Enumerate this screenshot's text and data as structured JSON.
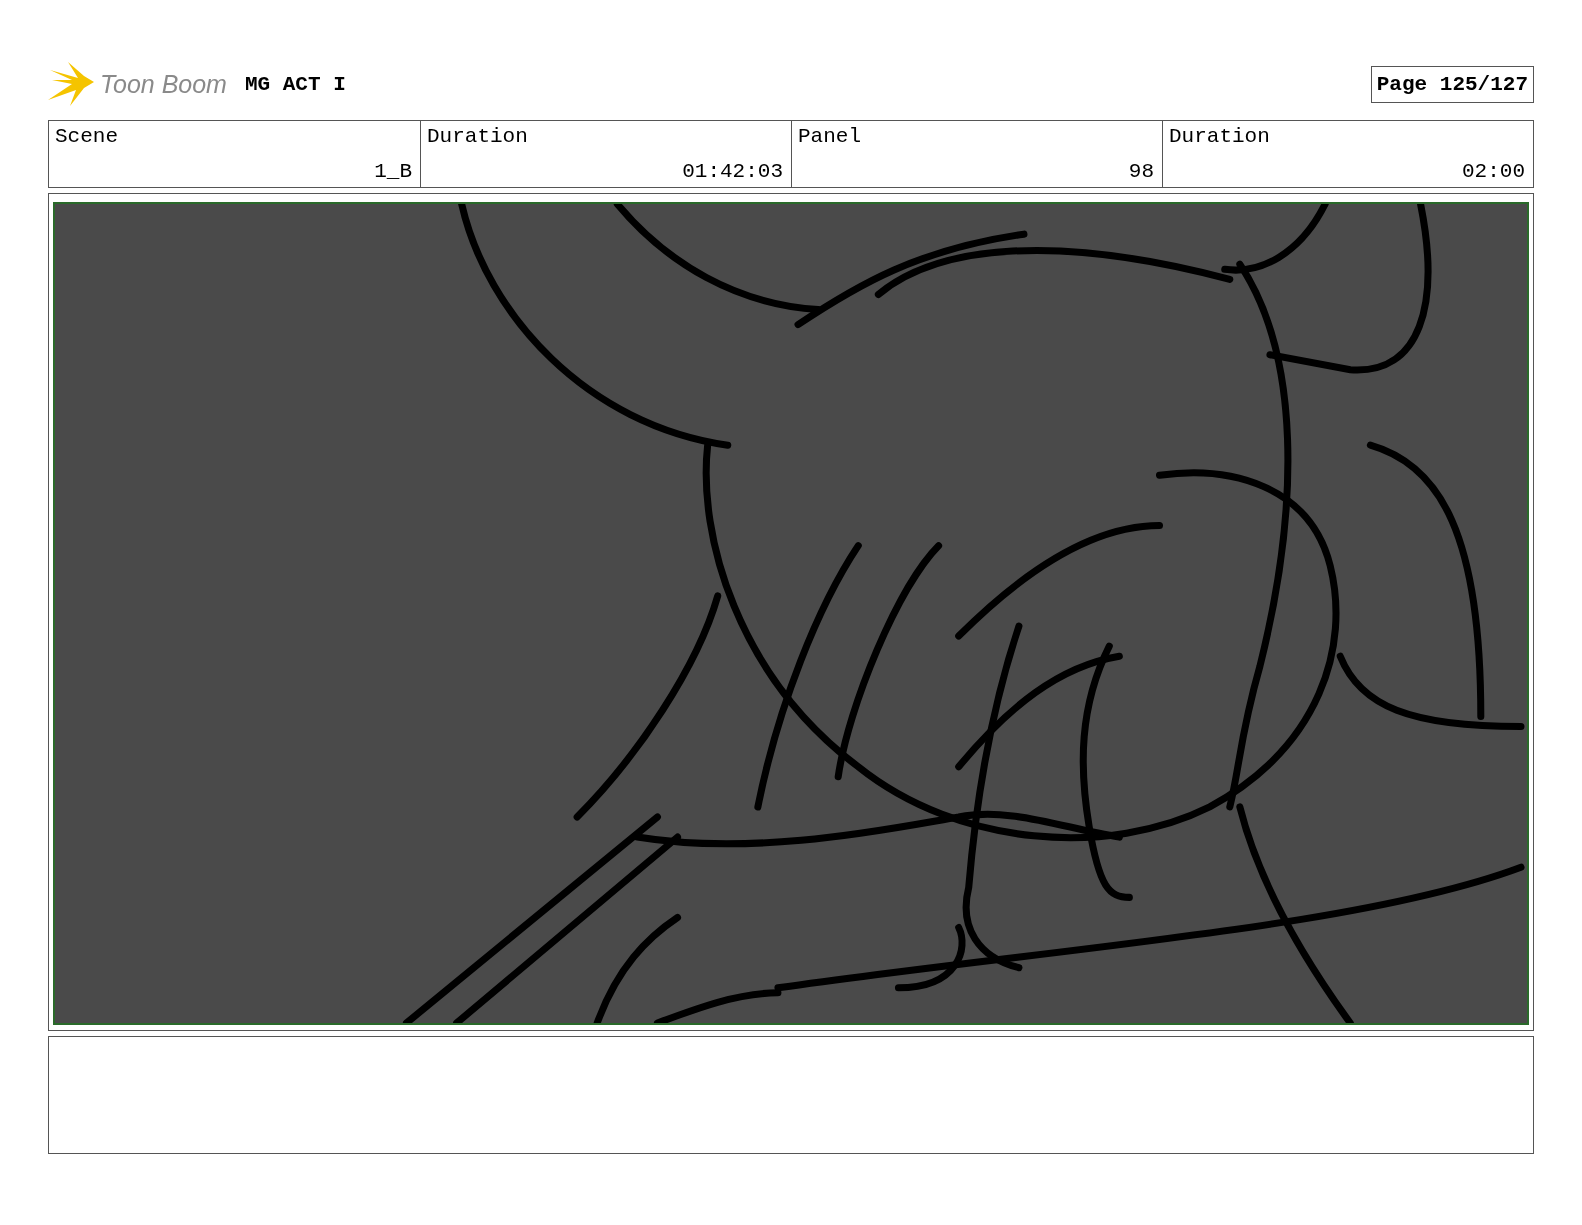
{
  "header": {
    "logo": "Toon Boom",
    "title": "MG ACT I",
    "page": "Page 125/127"
  },
  "info_table": {
    "columns": [
      "Scene",
      "Duration",
      "Panel",
      "Duration"
    ],
    "rows": [
      [
        "1_B",
        "01:42:03",
        "98",
        "02:00"
      ]
    ]
  }
}
